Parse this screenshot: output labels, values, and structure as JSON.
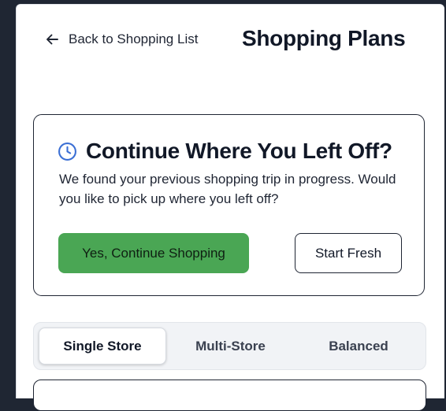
{
  "header": {
    "back_label": "Back to Shopping List",
    "title": "Shopping Plans",
    "back_icon": "arrow-left-icon"
  },
  "resume_prompt": {
    "icon": "clock-icon",
    "title": "Continue Where You Left Off?",
    "description": "We found your previous shopping trip in progress. Would you like to pick up where you left off?",
    "continue_label": "Yes, Continue Shopping",
    "fresh_label": "Start Fresh"
  },
  "plan_modes": {
    "tabs": [
      {
        "label": "Single Store",
        "active": true
      },
      {
        "label": "Multi-Store",
        "active": false
      },
      {
        "label": "Balanced",
        "active": false
      }
    ]
  },
  "colors": {
    "accent_green": "#4aa654",
    "clock_blue": "#3b6fd4",
    "page_background": "#1f2633"
  }
}
